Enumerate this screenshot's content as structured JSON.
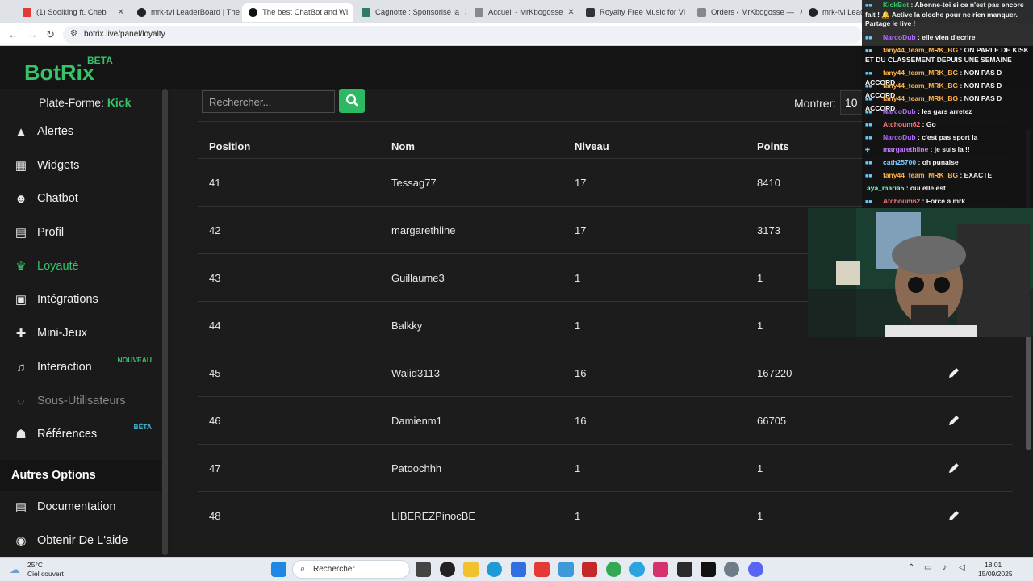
{
  "browser": {
    "tabs": [
      {
        "label": "(1) Soolking ft. Cheb",
        "color": "#e53935"
      },
      {
        "label": "mrk-tvi LeaderBoard | The",
        "color": "#222222"
      },
      {
        "label": "The best ChatBot and Wi",
        "color": "#111111"
      },
      {
        "label": "Cagnotte : Sponsorisé la",
        "color": "#2e7d6b"
      },
      {
        "label": "Accueil - MrKbogosse",
        "color": "#666666"
      },
      {
        "label": "Royalty Free Music for Vi",
        "color": "#333333"
      },
      {
        "label": "Orders ‹ MrKbogosse —",
        "color": "#666666"
      },
      {
        "label": "mrk-tvi Leade",
        "color": "#222222"
      }
    ],
    "url": "botrix.live/panel/loyalty"
  },
  "app": {
    "logo": "BotRix",
    "logo_badge": "BETA"
  },
  "sidebar": {
    "platform_label": "Plate-Forme:",
    "platform_value": "Kick",
    "items": [
      {
        "label": "Alertes",
        "icon": "warning-icon",
        "glyph": "▲"
      },
      {
        "label": "Widgets",
        "icon": "grid-icon",
        "glyph": "▦"
      },
      {
        "label": "Chatbot",
        "icon": "robot-icon",
        "glyph": "☻"
      },
      {
        "label": "Profil",
        "icon": "id-card-icon",
        "glyph": "▤"
      },
      {
        "label": "Loyauté",
        "icon": "trophy-icon",
        "glyph": "♛"
      },
      {
        "label": "Intégrations",
        "icon": "plug-icon",
        "glyph": "▣"
      },
      {
        "label": "Mini-Jeux",
        "icon": "gamepad-icon",
        "glyph": "✚"
      },
      {
        "label": "Interaction",
        "icon": "music-icon",
        "glyph": "♫",
        "badge": "NOUVEAU"
      },
      {
        "label": "Sous-Utilisateurs",
        "icon": "users-icon",
        "glyph": "◌"
      },
      {
        "label": "Références",
        "icon": "users-icon",
        "glyph": "☗",
        "badge": "BÉTA"
      }
    ],
    "section_title": "Autres Options",
    "options": [
      {
        "label": "Documentation",
        "icon": "book-icon",
        "glyph": "▤"
      },
      {
        "label": "Obtenir De L'aide",
        "icon": "discord-icon",
        "glyph": "◉"
      }
    ],
    "active_color": "#35c46a",
    "badge_color_new": "#35c46a",
    "badge_color_beta": "#3fb8d8"
  },
  "main": {
    "search_placeholder": "Rechercher...",
    "show_label": "Montrer:",
    "show_value": "10",
    "columns": [
      "Position",
      "Nom",
      "Niveau",
      "Points"
    ],
    "rows": [
      {
        "position": "41",
        "name": "Tessag77",
        "level": "17",
        "points": "8410"
      },
      {
        "position": "42",
        "name": "margarethline",
        "level": "17",
        "points": "3173"
      },
      {
        "position": "43",
        "name": "Guillaume3",
        "level": "1",
        "points": "1"
      },
      {
        "position": "44",
        "name": "Balkky",
        "level": "1",
        "points": "1"
      },
      {
        "position": "45",
        "name": "Walid3113",
        "level": "16",
        "points": "167220"
      },
      {
        "position": "46",
        "name": "Damienm1",
        "level": "16",
        "points": "66705"
      },
      {
        "position": "47",
        "name": "Patoochhh",
        "level": "1",
        "points": "1"
      },
      {
        "position": "48",
        "name": "LIBEREZPinocBE",
        "level": "1",
        "points": "1"
      }
    ]
  },
  "chat": {
    "lines": [
      {
        "user": "KickBot",
        "text": "Abonne-toi si ce n'est pas encore fait ! 🔔 Active la cloche pour ne rien manquer. Partage le live !",
        "color": "#35c46a"
      },
      {
        "user": "NarcoDub",
        "text": "elle vien d'ecrire",
        "color": "#b36bff"
      },
      {
        "user": "fany44_team_MRK_BG",
        "text": "ON PARLE DE KISK ET DU CLASSEMENT DEPUIS UNE SEMAINE",
        "color": "#ffb14a"
      },
      {
        "user": "fany44_team_MRK_BG",
        "text": "NON PAS D ACCORD",
        "color": "#ffb14a"
      },
      {
        "user": "fany44_team_MRK_BG",
        "text": "NON PAS D ACCORD",
        "color": "#ffb14a"
      },
      {
        "user": "fany44_team_MRK_BG",
        "text": "NON PAS D ACCORD",
        "color": "#ffb14a"
      },
      {
        "user": "NarcoDub",
        "text": "les gars arretez",
        "color": "#b36bff"
      },
      {
        "user": "Atchoum62",
        "text": "Go",
        "color": "#ff7a7a"
      },
      {
        "user": "NarcoDub",
        "text": "c'est pas sport la",
        "color": "#b36bff"
      },
      {
        "user": "margarethline",
        "text": "je suis la !!",
        "color": "#c77dff"
      },
      {
        "user": "cath25700",
        "text": "oh punaise",
        "color": "#7fc9ff"
      },
      {
        "user": "fany44_team_MRK_BG",
        "text": "EXACTE",
        "color": "#ffb14a"
      },
      {
        "user": "aya_maria5",
        "text": "oui elle est",
        "color": "#7fffd4"
      },
      {
        "user": "Atchoum62",
        "text": "Force a mrk",
        "color": "#ff7a7a"
      }
    ]
  },
  "taskbar": {
    "weather_temp": "25°C",
    "weather_desc": "Ciel couvert",
    "search_placeholder": "Rechercher",
    "time": "18:01",
    "date": "15/09/2025"
  }
}
